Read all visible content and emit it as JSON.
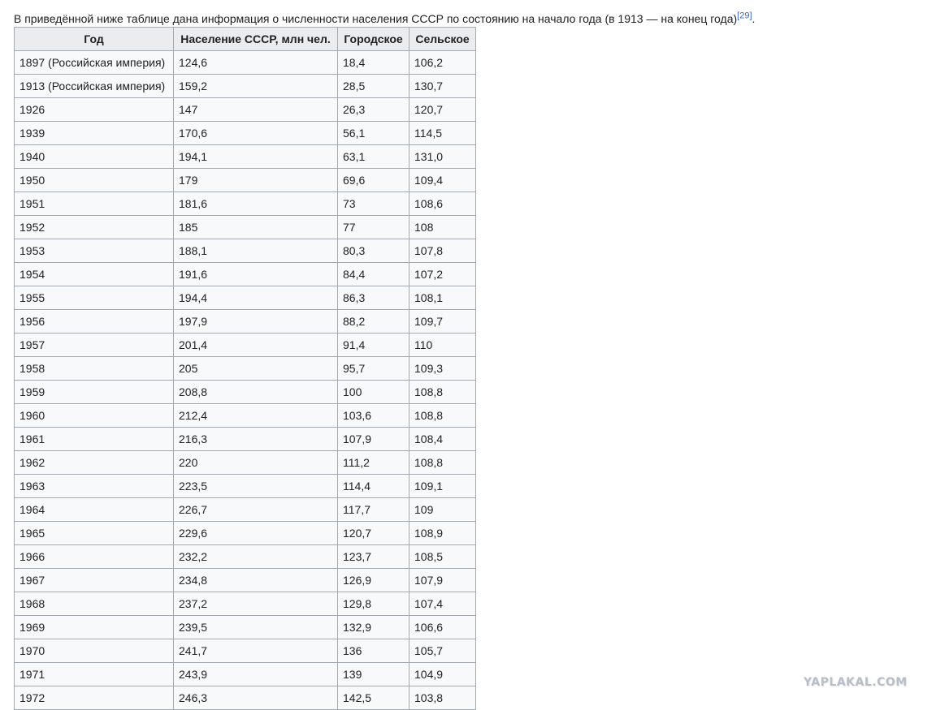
{
  "intro": {
    "text": "В приведённой ниже таблице дана информация о численности населения СССР по состоянию на начало года (в 1913 — на конец года)",
    "ref": "[29]",
    "trailing": "."
  },
  "table": {
    "headers": [
      "Год",
      "Население СССР, млн чел.",
      "Городское",
      "Сельское"
    ],
    "rows": [
      [
        "1897 (Российская империя)",
        "124,6",
        "18,4",
        "106,2"
      ],
      [
        "1913 (Российская империя)",
        "159,2",
        "28,5",
        "130,7"
      ],
      [
        "1926",
        "147",
        "26,3",
        "120,7"
      ],
      [
        "1939",
        "170,6",
        "56,1",
        "114,5"
      ],
      [
        "1940",
        "194,1",
        "63,1",
        "131,0"
      ],
      [
        "1950",
        "179",
        "69,6",
        "109,4"
      ],
      [
        "1951",
        "181,6",
        "73",
        "108,6"
      ],
      [
        "1952",
        "185",
        "77",
        "108"
      ],
      [
        "1953",
        "188,1",
        "80,3",
        "107,8"
      ],
      [
        "1954",
        "191,6",
        "84,4",
        "107,2"
      ],
      [
        "1955",
        "194,4",
        "86,3",
        "108,1"
      ],
      [
        "1956",
        "197,9",
        "88,2",
        "109,7"
      ],
      [
        "1957",
        "201,4",
        "91,4",
        "110"
      ],
      [
        "1958",
        "205",
        "95,7",
        "109,3"
      ],
      [
        "1959",
        "208,8",
        "100",
        "108,8"
      ],
      [
        "1960",
        "212,4",
        "103,6",
        "108,8"
      ],
      [
        "1961",
        "216,3",
        "107,9",
        "108,4"
      ],
      [
        "1962",
        "220",
        "111,2",
        "108,8"
      ],
      [
        "1963",
        "223,5",
        "114,4",
        "109,1"
      ],
      [
        "1964",
        "226,7",
        "117,7",
        "109"
      ],
      [
        "1965",
        "229,6",
        "120,7",
        "108,9"
      ],
      [
        "1966",
        "232,2",
        "123,7",
        "108,5"
      ],
      [
        "1967",
        "234,8",
        "126,9",
        "107,9"
      ],
      [
        "1968",
        "237,2",
        "129,8",
        "107,4"
      ],
      [
        "1969",
        "239,5",
        "132,9",
        "106,6"
      ],
      [
        "1970",
        "241,7",
        "136",
        "105,7"
      ],
      [
        "1971",
        "243,9",
        "139",
        "104,9"
      ],
      [
        "1972",
        "246,3",
        "142,5",
        "103,8"
      ]
    ]
  },
  "watermark": {
    "text": "YAPLAKAL.COM"
  }
}
